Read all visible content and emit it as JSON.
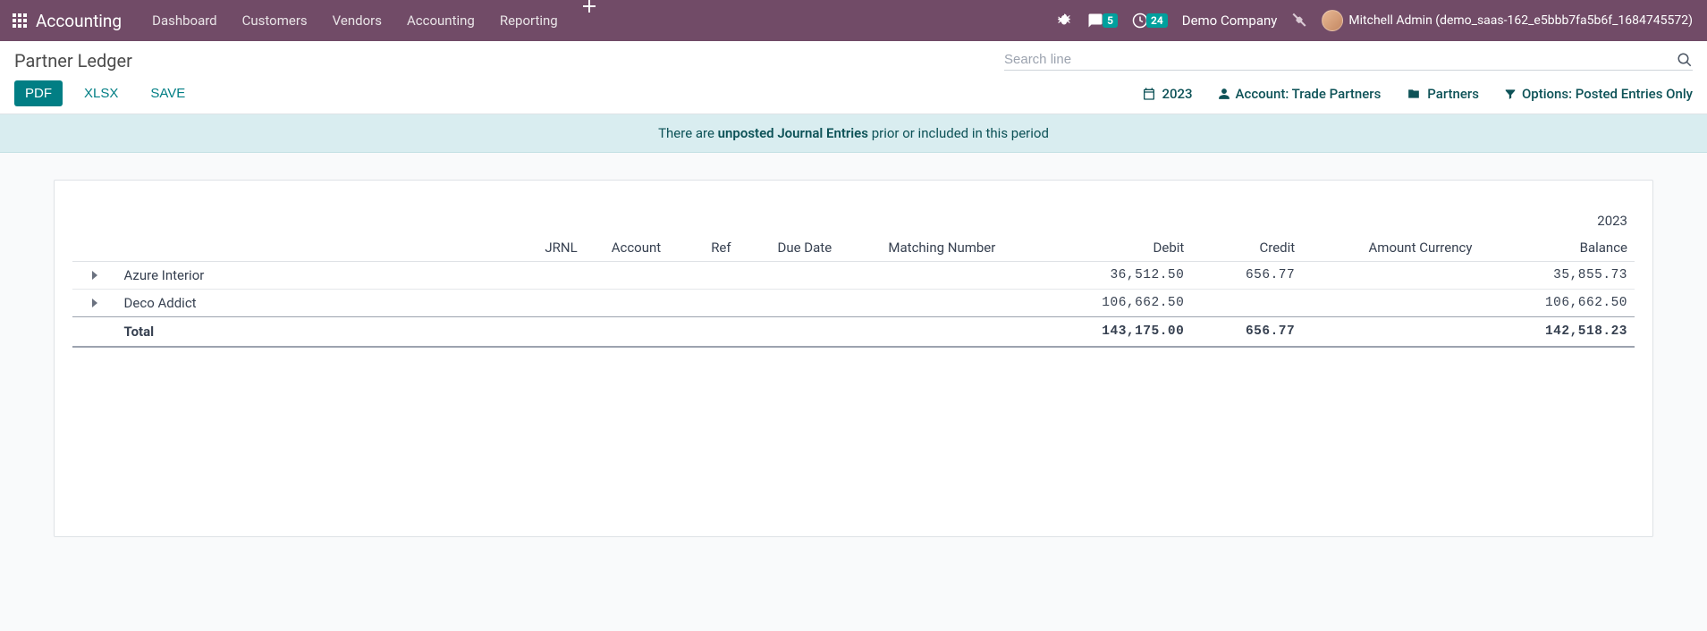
{
  "navbar": {
    "brand": "Accounting",
    "menu": [
      "Dashboard",
      "Customers",
      "Vendors",
      "Accounting",
      "Reporting"
    ],
    "messages_badge": "5",
    "activities_badge": "24",
    "company": "Demo Company",
    "user": "Mitchell Admin (demo_saas-162_e5bbb7fa5b6f_1684745572)"
  },
  "control_panel": {
    "title": "Partner Ledger",
    "search_placeholder": "Search line",
    "buttons": {
      "pdf": "PDF",
      "xlsx": "XLSX",
      "save": "SAVE"
    },
    "filters": {
      "date": "2023",
      "account": "Account: Trade Partners",
      "partners": "Partners",
      "options": "Options: Posted Entries Only"
    }
  },
  "banner": {
    "pre": "There are ",
    "strong": "unposted Journal Entries",
    "post": " prior or included in this period"
  },
  "report": {
    "year": "2023",
    "columns": {
      "jrnl": "JRNL",
      "account": "Account",
      "ref": "Ref",
      "due_date": "Due Date",
      "matching": "Matching Number",
      "debit": "Debit",
      "credit": "Credit",
      "amount_currency": "Amount Currency",
      "balance": "Balance"
    },
    "rows": [
      {
        "name": "Azure Interior",
        "debit": "36,512.50",
        "credit": "656.77",
        "amount_currency": "",
        "balance": "35,855.73"
      },
      {
        "name": "Deco Addict",
        "debit": "106,662.50",
        "credit": "",
        "amount_currency": "",
        "balance": "106,662.50"
      }
    ],
    "total": {
      "label": "Total",
      "debit": "143,175.00",
      "credit": "656.77",
      "amount_currency": "",
      "balance": "142,518.23"
    }
  }
}
